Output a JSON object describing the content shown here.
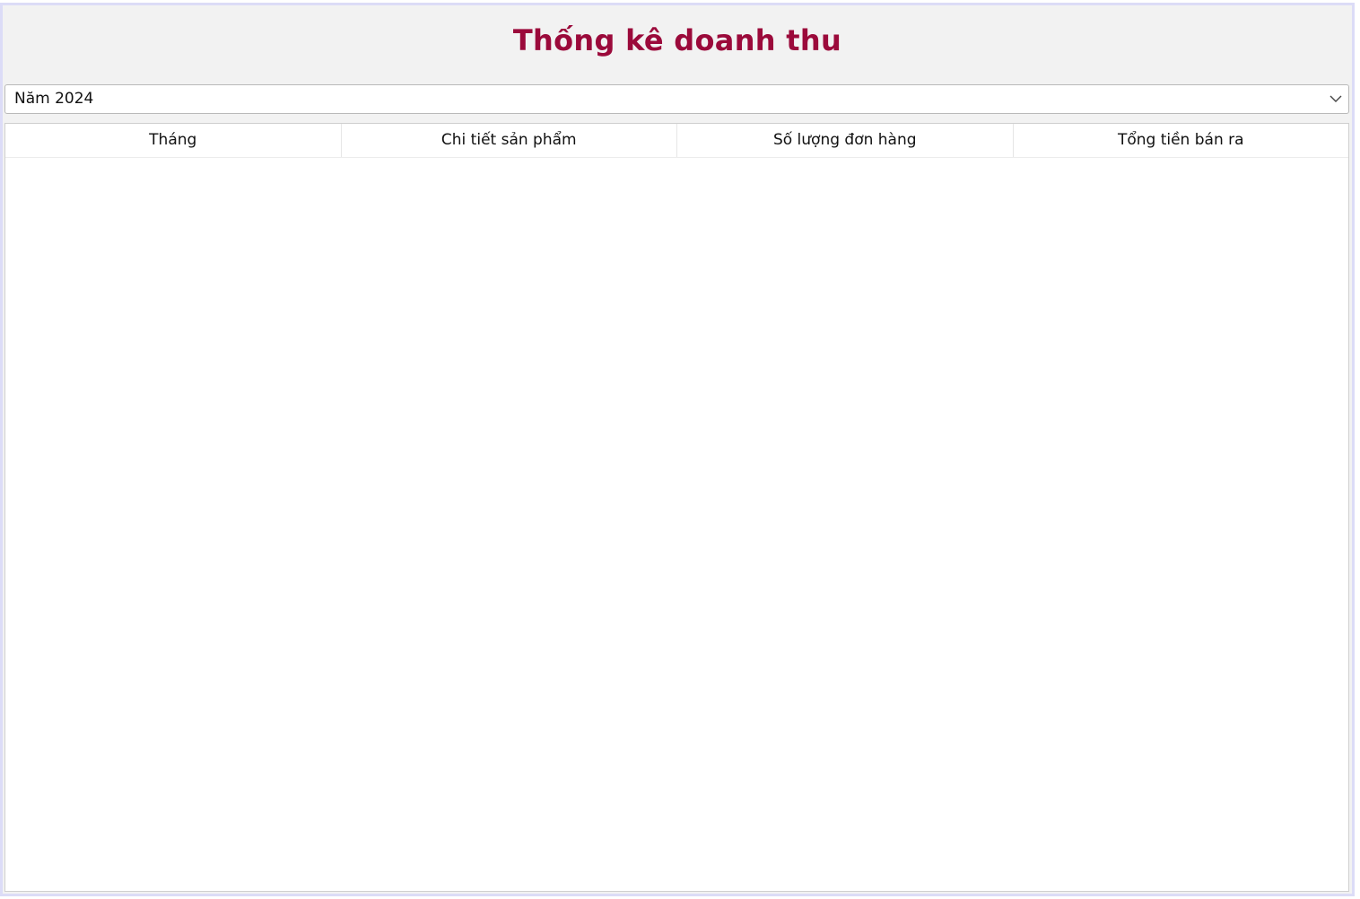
{
  "page": {
    "title": "Thống kê doanh thu",
    "title_color": "#9b0a3b"
  },
  "filter": {
    "year_selected": "Năm 2024",
    "icon": "chevron-down-icon"
  },
  "table": {
    "columns": [
      "Tháng",
      "Chi tiết sản phẩm",
      "Số lượng đơn hàng",
      "Tổng tiền bán ra"
    ],
    "rows": []
  }
}
